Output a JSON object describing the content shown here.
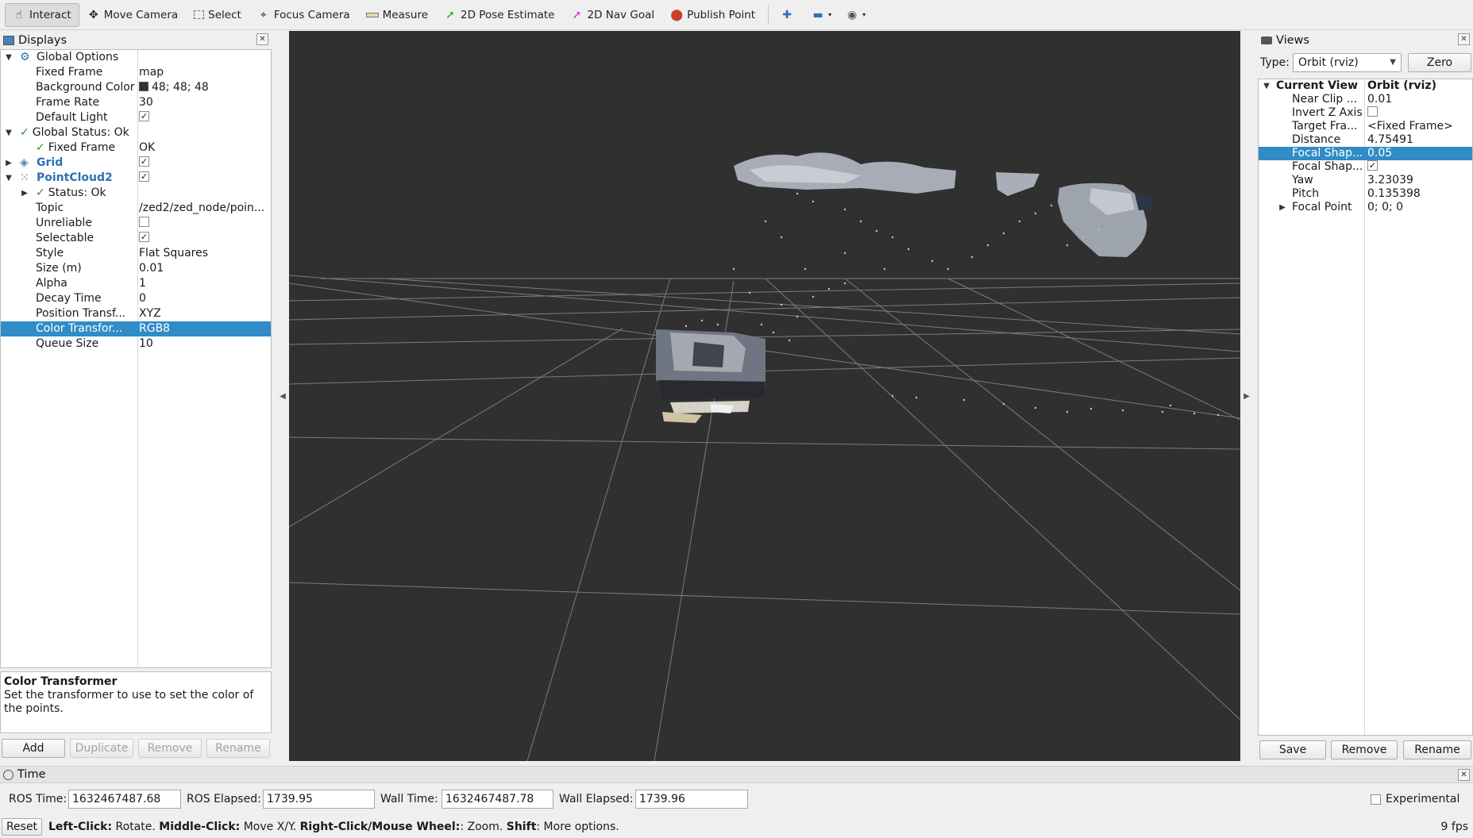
{
  "toolbar": {
    "tools": [
      {
        "label": "Interact",
        "icon": "hand-pointer-icon"
      },
      {
        "label": "Move Camera",
        "icon": "move-arrows-icon"
      },
      {
        "label": "Select",
        "icon": "select-rectangle-icon"
      },
      {
        "label": "Focus Camera",
        "icon": "crosshair-icon"
      },
      {
        "label": "Measure",
        "icon": "ruler-icon"
      },
      {
        "label": "2D Pose Estimate",
        "icon": "green-arrow-icon"
      },
      {
        "label": "2D Nav Goal",
        "icon": "magenta-arrow-icon"
      },
      {
        "label": "Publish Point",
        "icon": "map-pin-icon"
      }
    ]
  },
  "displays": {
    "title": "Displays",
    "rows": [
      {
        "label": "Global Options",
        "value": ""
      },
      {
        "label": "Fixed Frame",
        "value": "map"
      },
      {
        "label": "Background Color",
        "value": "48; 48; 48"
      },
      {
        "label": "Frame Rate",
        "value": "30"
      },
      {
        "label": "Default Light",
        "value": ""
      },
      {
        "label": "Global Status: Ok",
        "value": ""
      },
      {
        "label": "Fixed Frame",
        "value": "OK"
      },
      {
        "label": "Grid",
        "value": ""
      },
      {
        "label": "PointCloud2",
        "value": ""
      },
      {
        "label": "Status: Ok",
        "value": ""
      },
      {
        "label": "Topic",
        "value": "/zed2/zed_node/poin..."
      },
      {
        "label": "Unreliable",
        "value": ""
      },
      {
        "label": "Selectable",
        "value": ""
      },
      {
        "label": "Style",
        "value": "Flat Squares"
      },
      {
        "label": "Size (m)",
        "value": "0.01"
      },
      {
        "label": "Alpha",
        "value": "1"
      },
      {
        "label": "Decay Time",
        "value": "0"
      },
      {
        "label": "Position Transf...",
        "value": "XYZ"
      },
      {
        "label": "Color Transfor...",
        "value": "RGB8"
      },
      {
        "label": "Queue Size",
        "value": "10"
      }
    ],
    "description_title": "Color Transformer",
    "description_text": "Set the transformer to use to set the color of the points.",
    "buttons": {
      "add": "Add",
      "duplicate": "Duplicate",
      "remove": "Remove",
      "rename": "Rename"
    }
  },
  "views": {
    "title": "Views",
    "type_label": "Type:",
    "type_value": "Orbit (rviz)",
    "zero_label": "Zero",
    "rows": [
      {
        "label": "Current View",
        "value": "Orbit (rviz)"
      },
      {
        "label": "Near Clip ...",
        "value": "0.01"
      },
      {
        "label": "Invert Z Axis",
        "value": ""
      },
      {
        "label": "Target Fra...",
        "value": "<Fixed Frame>"
      },
      {
        "label": "Distance",
        "value": "4.75491"
      },
      {
        "label": "Focal Shap...",
        "value": "0.05"
      },
      {
        "label": "Focal Shap...",
        "value": ""
      },
      {
        "label": "Yaw",
        "value": "3.23039"
      },
      {
        "label": "Pitch",
        "value": "0.135398"
      },
      {
        "label": "Focal Point",
        "value": "0; 0; 0"
      }
    ],
    "buttons": {
      "save": "Save",
      "remove": "Remove",
      "rename": "Rename"
    }
  },
  "time": {
    "title": "Time",
    "ros_time_label": "ROS Time:",
    "ros_time": "1632467487.68",
    "ros_elapsed_label": "ROS Elapsed:",
    "ros_elapsed": "1739.95",
    "wall_time_label": "Wall Time:",
    "wall_time": "1632467487.78",
    "wall_elapsed_label": "Wall Elapsed:",
    "wall_elapsed": "1739.96",
    "experimental_label": "Experimental"
  },
  "statusbar": {
    "reset_label": "Reset",
    "left_click": "Left-Click:",
    "left_click_desc": " Rotate. ",
    "middle_click": "Middle-Click:",
    "middle_click_desc": " Move X/Y. ",
    "right_click": "Right-Click/Mouse Wheel:",
    "right_click_desc": ": Zoom. ",
    "shift": "Shift",
    "shift_desc": ": More options.",
    "fps": "9 fps"
  },
  "colors": {
    "selection": "#308cc6",
    "viewport_bg": "#303030",
    "display_link": "#2e6fb5",
    "status_ok": "#2f8a2f"
  }
}
